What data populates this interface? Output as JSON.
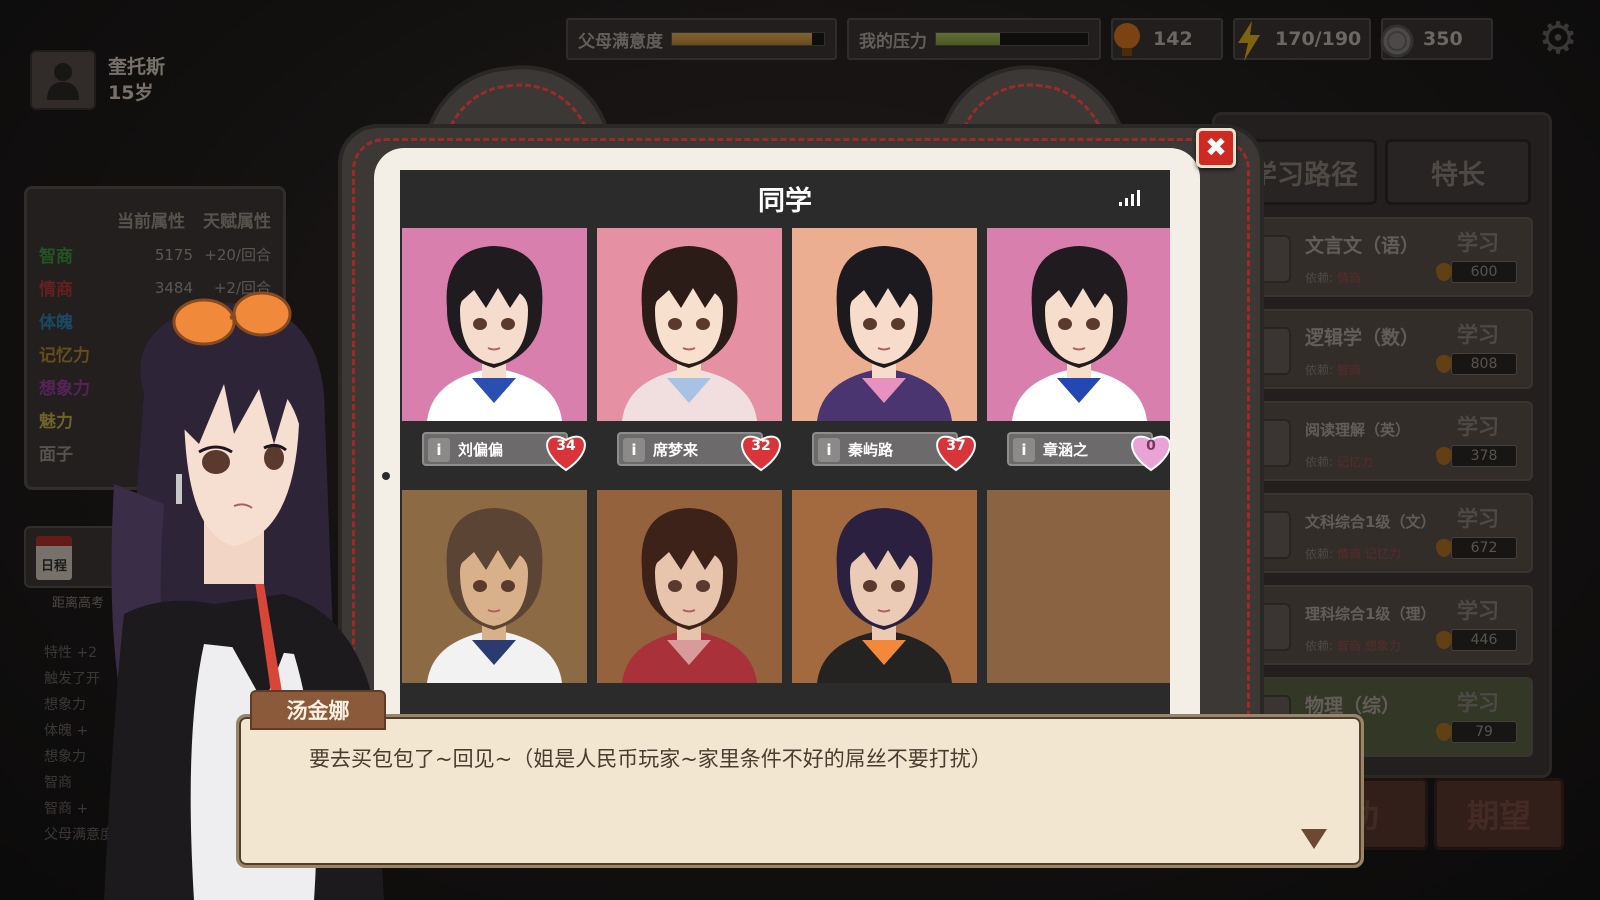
{
  "player": {
    "name": "奎托斯",
    "age": "15岁"
  },
  "top_bar": {
    "parent_satisfaction": {
      "label": "父母满意度",
      "fraction": 0.92
    },
    "stress": {
      "label": "我的压力",
      "fraction": 0.42
    },
    "bulbs": "142",
    "energy": "170/190",
    "coins": "350"
  },
  "attributes": {
    "header_current": "当前属性",
    "header_talent": "天赋属性",
    "rows": [
      {
        "name": "智商",
        "color": "#3d9b3d",
        "value": "5175",
        "talent": "+20/回合"
      },
      {
        "name": "情商",
        "color": "#b83a3a",
        "value": "3484",
        "talent": "+2/回合"
      },
      {
        "name": "体魄",
        "color": "#2f86b4",
        "value": "",
        "talent": ""
      },
      {
        "name": "记忆力",
        "color": "#b88a2f",
        "value": "",
        "talent": ""
      },
      {
        "name": "想象力",
        "color": "#9d3fa0",
        "value": "",
        "talent": ""
      },
      {
        "name": "魅力",
        "color": "#c9b24a",
        "value": "",
        "talent": ""
      },
      {
        "name": "面子",
        "color": "#9d958c",
        "value": "",
        "talent": ""
      }
    ]
  },
  "diary": {
    "icon_label": "日程",
    "subtitle": "距离高考"
  },
  "log": [
    "特性 +2",
    "触发了开",
    "想象力",
    "体魄 +",
    "想象力",
    "智商",
    "智商 +",
    "父母满意度 +"
  ],
  "right_panel": {
    "tabs": [
      "学习路径",
      "特长"
    ],
    "study_label": "学习",
    "req_label": "依赖:",
    "courses": [
      {
        "name": "文言文（语）",
        "req": "情商",
        "cost": "600"
      },
      {
        "name": "逻辑学（数）",
        "req": "智商",
        "cost": "808"
      },
      {
        "name": "阅读理解（英）",
        "req": "记忆力",
        "cost": "378"
      },
      {
        "name": "文科综合1级（文）",
        "req": "情商 记忆力",
        "cost": "672"
      },
      {
        "name": "理科综合1级（理）",
        "req": "智商 想象力",
        "cost": "446"
      },
      {
        "name": "物理（综）",
        "req": "",
        "cost": "79"
      }
    ],
    "bottom_buttons": [
      "功",
      "期望"
    ]
  },
  "modal": {
    "title": "同学",
    "close": "✖",
    "classmates": [
      {
        "name": "刘偏偏",
        "affection": "34",
        "bg": "#d97fae",
        "hair": "#1f1b1e",
        "skin": "#f6dccd",
        "outfit": "#ffffff",
        "accent": "#2a4fb0"
      },
      {
        "name": "席梦来",
        "affection": "32",
        "bg": "#e590a3",
        "hair": "#2b1c18",
        "skin": "#f8e0cf",
        "outfit": "#f1dfe0",
        "accent": "#a8c2e6"
      },
      {
        "name": "秦屿路",
        "affection": "37",
        "bg": "#ebae90",
        "hair": "#1c1a1e",
        "skin": "#f8dccb",
        "outfit": "#4a3570",
        "accent": "#e890c0"
      },
      {
        "name": "章涵之",
        "affection": "0",
        "bg": "#d97fae",
        "hair": "#201b1f",
        "skin": "#f7ddcc",
        "outfit": "#ffffff",
        "accent": "#2347b3"
      },
      {
        "name": "",
        "affection": "",
        "bg": "#8c6a44",
        "hair": "#5b4433",
        "skin": "#d8b08a",
        "outfit": "#f2f2f2",
        "accent": "#2a3b70"
      },
      {
        "name": "",
        "affection": "",
        "bg": "#95623e",
        "hair": "#3c2219",
        "skin": "#e8c4ad",
        "outfit": "#a8313a",
        "accent": "#d89a9a"
      },
      {
        "name": "",
        "affection": "",
        "bg": "#a36a3f",
        "hair": "#2b2040",
        "skin": "#eccbb6",
        "outfit": "#252222",
        "accent": "#f2893a"
      },
      {
        "name": "",
        "affection": "",
        "bg": "#8a6442",
        "hair": "",
        "skin": "",
        "outfit": "",
        "accent": ""
      }
    ]
  },
  "dialog": {
    "speaker": "汤金娜",
    "text": "要去买包包了~回见~（姐是人民币玩家~家里条件不好的屌丝不要打扰）"
  }
}
